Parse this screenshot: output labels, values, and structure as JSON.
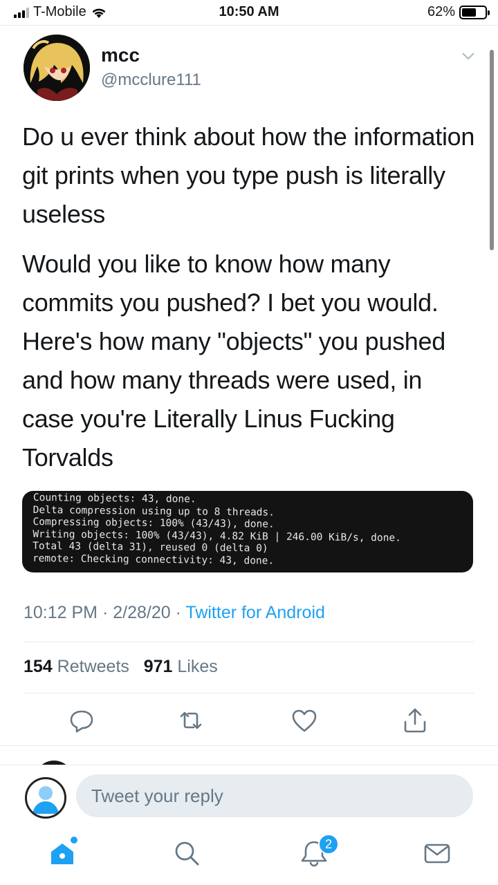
{
  "status_bar": {
    "carrier": "T-Mobile",
    "time": "10:50 AM",
    "battery_percent": "62%",
    "battery_level": 0.62
  },
  "tweet": {
    "display_name": "mcc",
    "handle": "@mcclure111",
    "paragraphs": [
      "Do u ever think about how the information git prints when you type push is literally useless",
      "Would you like to know how many commits you pushed? I bet you would. Here's how many \"objects\" you pushed and how many threads were used, in case you're Literally Linus Fucking Torvalds"
    ],
    "media_lines": [
      "Counting objects: 43, done.",
      "Delta compression using up to 8 threads.",
      "Compressing objects: 100% (43/43), done.",
      "Writing objects: 100% (43/43), 4.82 KiB | 246.00 KiB/s, done.",
      "Total 43 (delta 31), reused 0 (delta 0)",
      "remote: Checking connectivity: 43, done."
    ],
    "time": "10:12 PM",
    "date": "2/28/20",
    "source": "Twitter for Android",
    "retweet_count": "154",
    "retweet_label": "Retweets",
    "like_count": "971",
    "like_label": "Likes"
  },
  "reply": {
    "placeholder": "Tweet your reply"
  },
  "tab_bar": {
    "notifications_badge": "2"
  },
  "colors": {
    "accent": "#1da1f2",
    "muted": "#657786",
    "text": "#14171a",
    "divider": "#e6ecf0"
  },
  "icons": {
    "actions": [
      "reply-icon",
      "retweet-icon",
      "like-icon",
      "share-icon"
    ],
    "tabs": [
      "home-icon",
      "search-icon",
      "notifications-icon",
      "messages-icon"
    ]
  }
}
